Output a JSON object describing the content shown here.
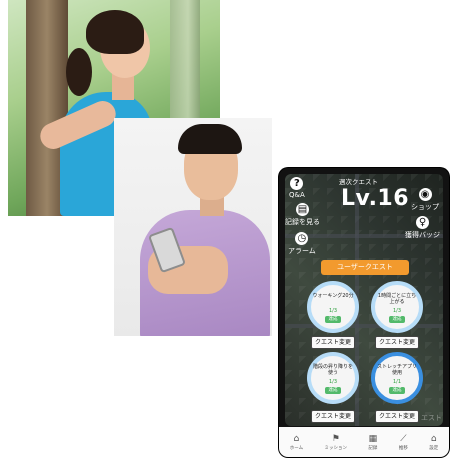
{
  "app": {
    "quest_title": "週次クエスト",
    "level": "Lv.16",
    "user_quest_button": "ユーザークエスト",
    "buttons": {
      "qa": "Q&A",
      "record": "記録を見る",
      "alarm": "アラーム",
      "shop": "ショップ",
      "badge": "獲得バッジ"
    },
    "quests": [
      {
        "name": "ウォーキング20分",
        "progress": "1/3",
        "go": "達成",
        "change": "クエスト変更",
        "active": false
      },
      {
        "name": "1時間ごとに立ち上がる",
        "progress": "1/3",
        "go": "達成",
        "change": "クエスト変更",
        "active": false
      },
      {
        "name": "階段の昇り降りを使う",
        "progress": "1/3",
        "go": "達成",
        "change": "クエスト変更",
        "active": false
      },
      {
        "name": "ストレッチアプリ使用",
        "progress": "1/1",
        "go": "達成",
        "change": "クエスト変更",
        "active": true
      }
    ],
    "watermark": "エスト",
    "tabs": [
      {
        "icon": "home-icon",
        "glyph": "⌂",
        "label": "ホーム"
      },
      {
        "icon": "flag-icon",
        "glyph": "⚑",
        "label": "ミッション"
      },
      {
        "icon": "calendar-icon",
        "glyph": "▦",
        "label": "記録"
      },
      {
        "icon": "chart-icon",
        "glyph": "⟋",
        "label": "推移"
      },
      {
        "icon": "house-icon",
        "glyph": "⌂",
        "label": "設定"
      }
    ]
  }
}
